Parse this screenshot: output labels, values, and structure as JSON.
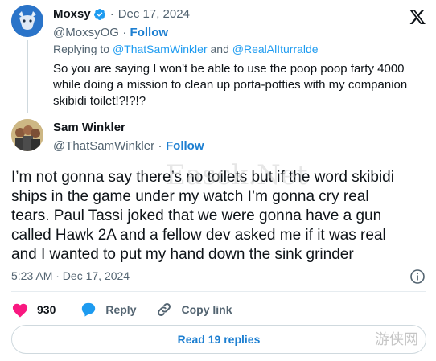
{
  "reply_tweet": {
    "author_name": "Moxsy",
    "dot": "·",
    "date": "Dec 17, 2024",
    "handle": "@MoxsyOG",
    "follow_label": "Follow",
    "replying_prefix": "Replying to ",
    "replying_to_1": "@ThatSamWinkler",
    "replying_and": " and ",
    "replying_to_2": "@RealAlIturralde",
    "text_line1": "So you are saying I won't be able to use the poop poop farty 4000",
    "text_line2": "while doing a mission to clean up porta-potties with my companion",
    "text_line3": "skibidi toilet!?!?!?"
  },
  "main_tweet": {
    "author_name": "Sam Winkler",
    "handle": "@ThatSamWinkler",
    "dot": "·",
    "follow_label": "Follow",
    "text_line1": "I’m not gonna say there’s no toilets but if the word skibidi",
    "text_line2": "ships in the game under my watch I’m gonna cry real",
    "text_line3": "tears. Paul Tassi joked that we were gonna have a gun",
    "text_line4": "called Hawk 2A and a fellow dev asked me if it was real",
    "text_line5": "and I wanted to put my hand down the sink grinder",
    "timestamp": "5:23 AM · Dec 17, 2024"
  },
  "actions": {
    "like_count": "930",
    "reply_label": "Reply",
    "copy_label": "Copy link"
  },
  "read_replies_label": "Read 19 replies",
  "watermarks": {
    "center": "Easck.Net",
    "corner": "游侠网"
  },
  "colors": {
    "verified": "#1d9bf0",
    "like": "#f91880",
    "link": "#1d7fd1"
  },
  "icons": {
    "x_logo": "x-logo-icon",
    "info": "info-icon",
    "heart": "heart-icon",
    "reply": "reply-bubble-icon",
    "link": "link-icon"
  }
}
